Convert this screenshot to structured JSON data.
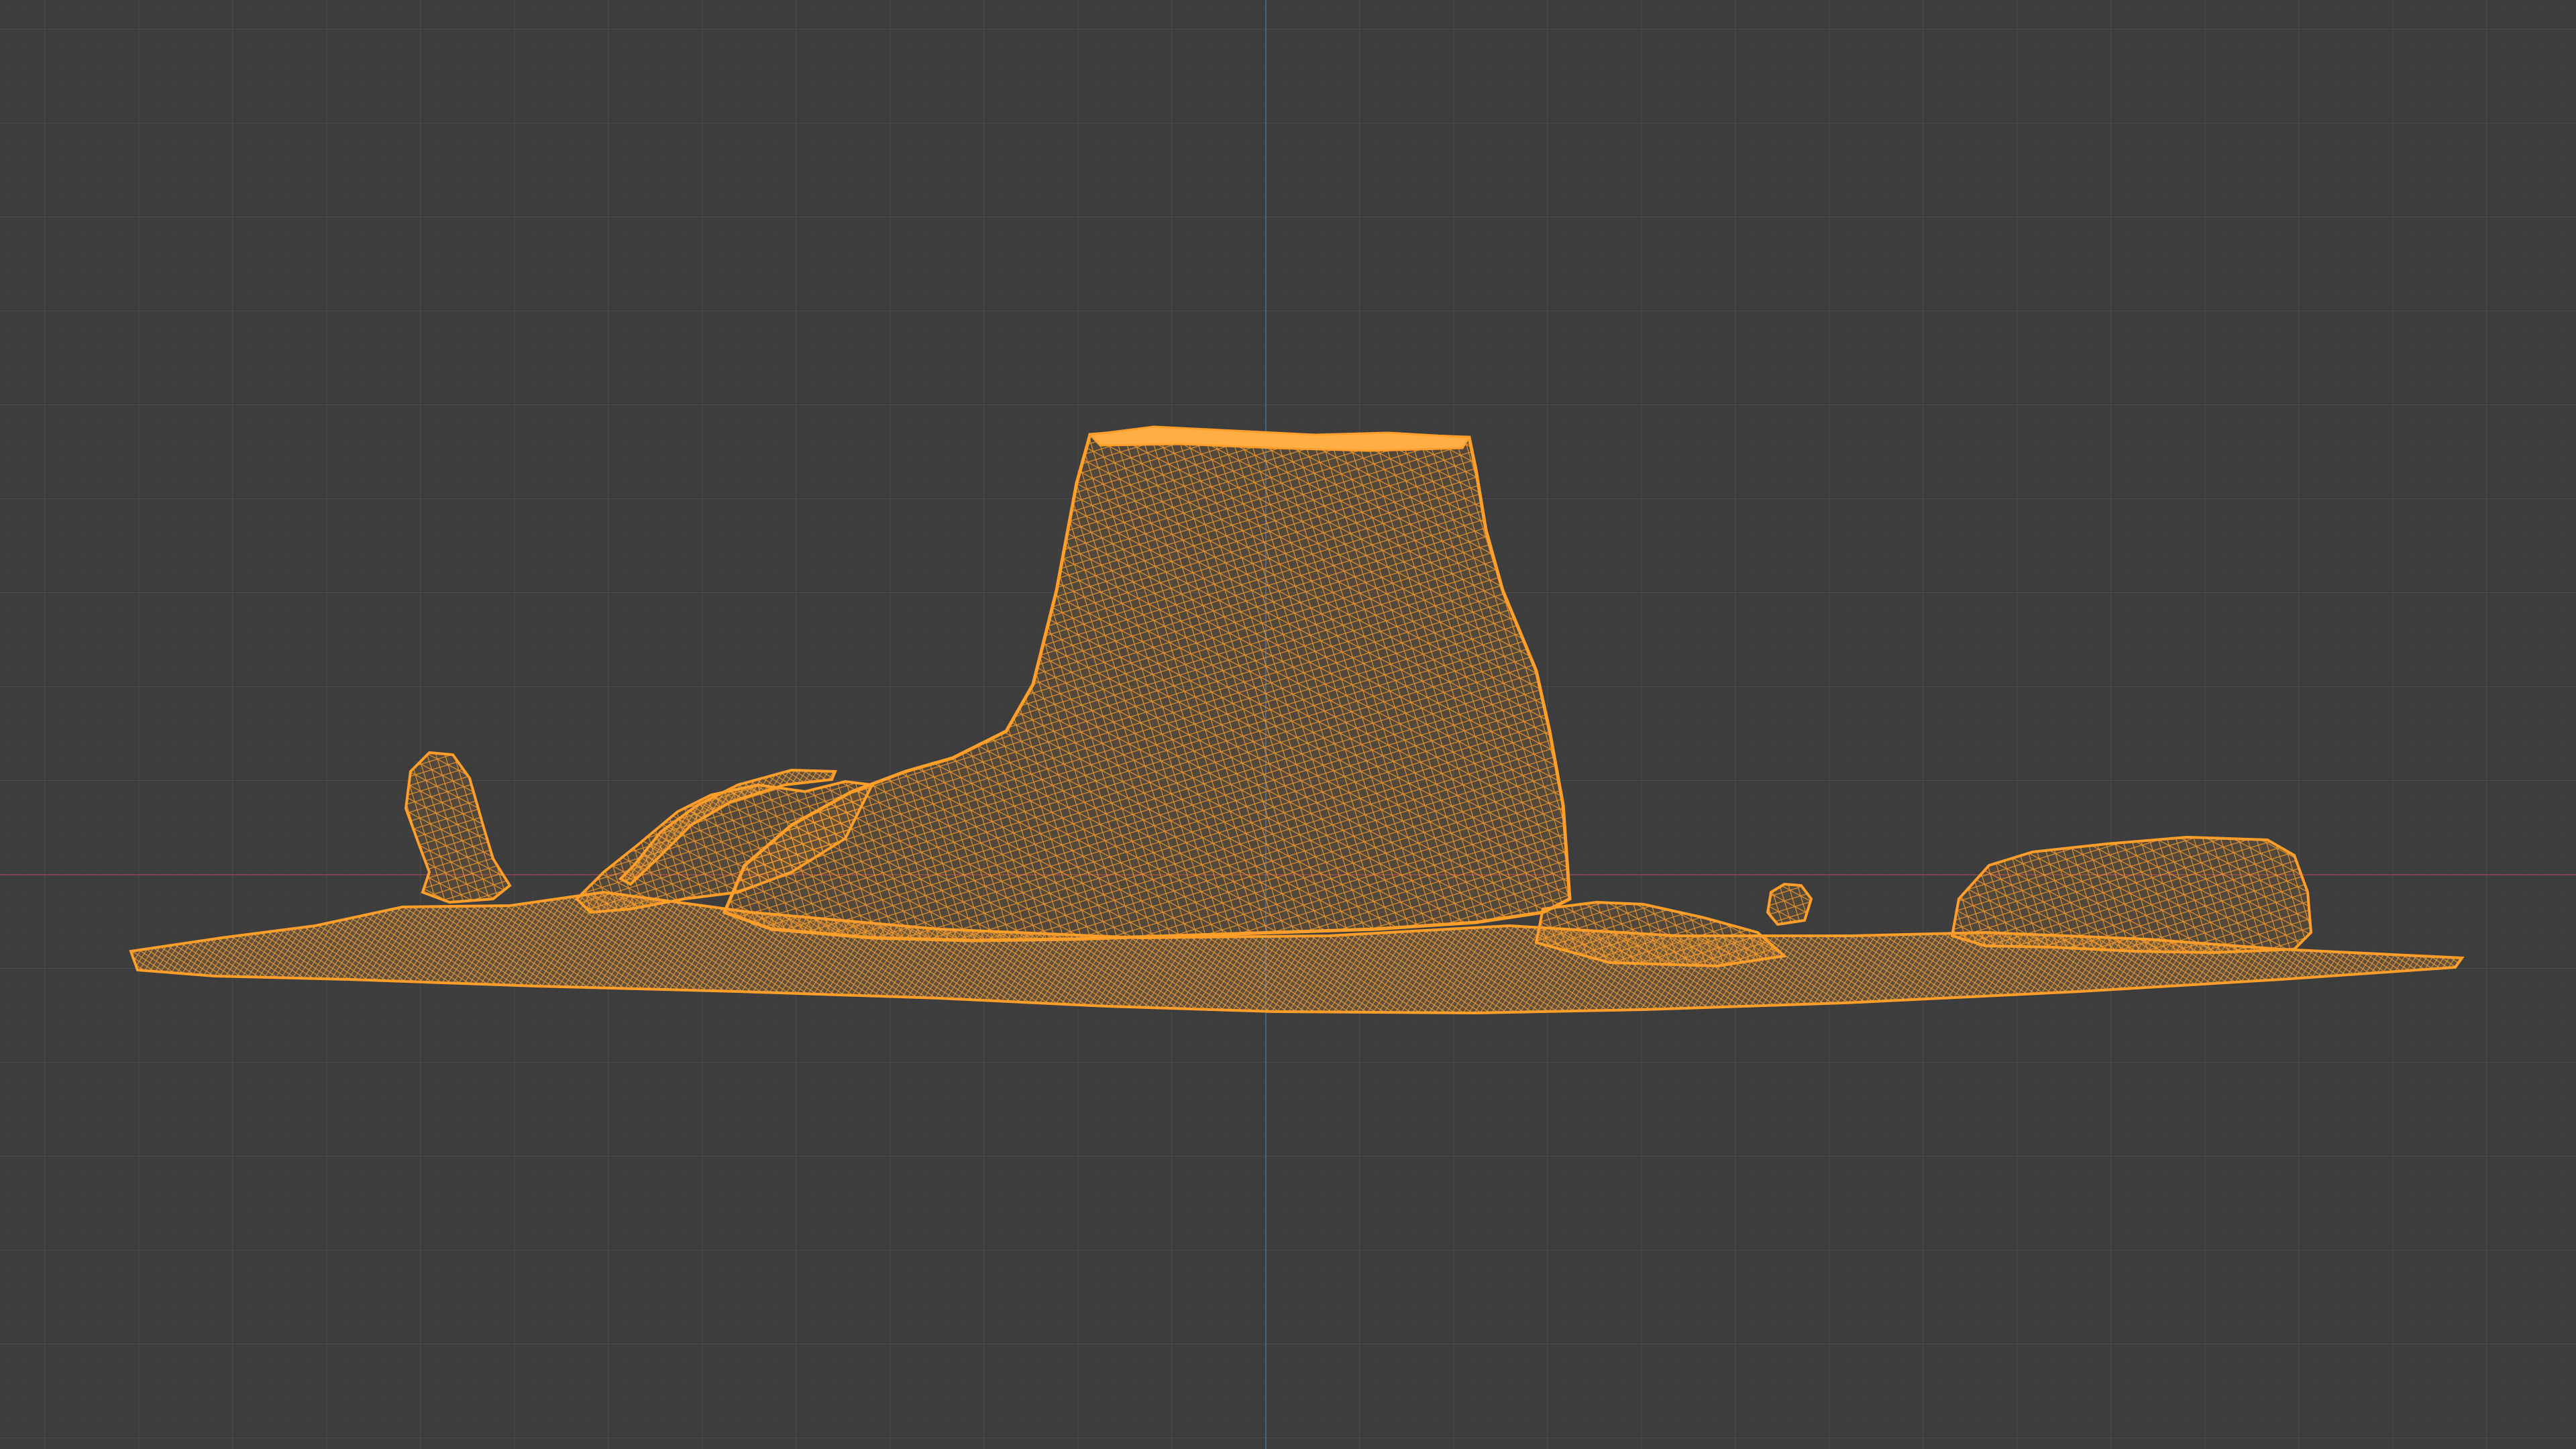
{
  "viewport": {
    "background_color": "#3d3d3d",
    "axis_x_color": "#aa4650",
    "axis_z_color": "#4e78b8"
  },
  "object": {
    "selected": true,
    "display_mode": "wireframe",
    "wire_color": "#ff9f2a",
    "subject": "tree-stump-photogrammetry-mesh"
  }
}
